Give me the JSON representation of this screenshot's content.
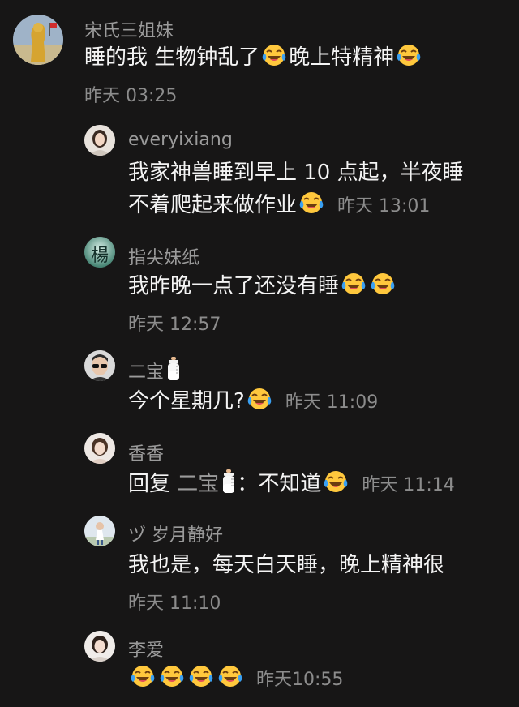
{
  "comments": [
    {
      "name": "宋氏三姐妹",
      "text_a": "睡的我 生物钟乱了",
      "text_b": "晚上特精神",
      "time": "昨天 03:25",
      "avatar_icon": "statue-avatar-icon"
    },
    {
      "name": "everyixiang",
      "line1": "我家神兽睡到早上 10 点起，半夜睡",
      "line2": "不着爬起来做作业",
      "time": "昨天 13:01",
      "avatar_icon": "woman-portrait-avatar-icon"
    },
    {
      "name": "指尖妹纸",
      "text": "我昨晚一点了还没有睡",
      "time": "昨天 12:57",
      "avatar_icon": "yang-character-avatar-icon",
      "avatar_char": "楊"
    },
    {
      "name": "二宝",
      "text": "今个星期几?",
      "time": "昨天 11:09",
      "avatar_icon": "sunglasses-man-avatar-icon"
    },
    {
      "name": "香香",
      "reply_prefix": "回复",
      "reply_to": "二宝",
      "reply_colon": "：",
      "text": "不知道",
      "time": "昨天 11:14",
      "avatar_icon": "woman-avatar-icon"
    },
    {
      "name": "ヅ 岁月静好",
      "text": "我也是，每天白天睡，晚上精神很",
      "time": "昨天 11:10",
      "avatar_icon": "child-avatar-icon"
    },
    {
      "name": "李爱",
      "time": "昨天10:55",
      "avatar_icon": "woman-avatar-icon"
    }
  ],
  "icons": {
    "emoji": "tears-of-joy-emoji-icon",
    "bottle": "baby-bottle-icon"
  },
  "colors": {
    "background": "#171616",
    "name": "#9b9b9b",
    "text": "#f4f4f4",
    "time": "#8c8c8c",
    "emoji_face": "#ffc83d",
    "emoji_tear": "#3aa0f2"
  }
}
